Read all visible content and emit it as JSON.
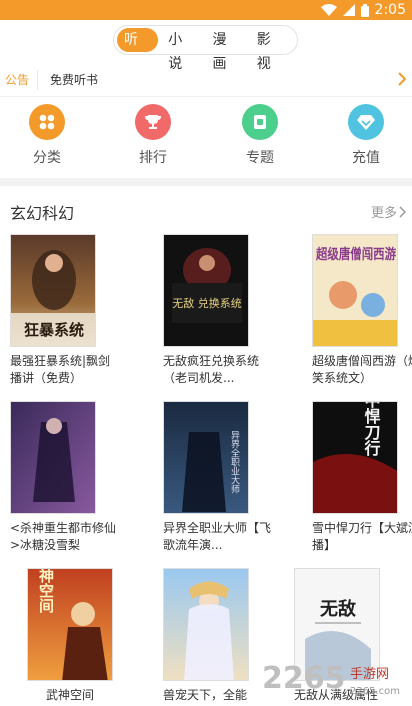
{
  "status": {
    "time": "2:05"
  },
  "tabs": [
    {
      "label": "听书",
      "active": true
    },
    {
      "label": "小说",
      "active": false
    },
    {
      "label": "漫画",
      "active": false
    },
    {
      "label": "影视",
      "active": false
    }
  ],
  "notice": {
    "tag": "公告",
    "text": "免费听书"
  },
  "quick_nav": [
    {
      "label": "分类",
      "icon": "grid-icon",
      "color": "#f39a2a"
    },
    {
      "label": "排行",
      "icon": "trophy-icon",
      "color": "#f06a6a"
    },
    {
      "label": "专题",
      "icon": "topic-icon",
      "color": "#4ccf8c"
    },
    {
      "label": "充值",
      "icon": "diamond-icon",
      "color": "#4fc3e0"
    }
  ],
  "section": {
    "title": "玄幻科幻",
    "more": "更多"
  },
  "books": [
    {
      "title": "最强狂暴系统|飘剑播讲（免费）",
      "cover_text": "狂暴系统"
    },
    {
      "title": "无敌疯狂兑换系统（老司机发...",
      "cover_text": "无敌 兑换系统"
    },
    {
      "title": "超级唐僧闯西游（爆笑系统文）",
      "cover_text": "超级唐僧闯西游"
    },
    {
      "title": "<杀神重生都市修仙>冰糖没雪梨",
      "cover_text": ""
    },
    {
      "title": "异界全职业大师【飞歌流年演...",
      "cover_text": "异界全职业大师"
    },
    {
      "title": "雪中悍刀行【大斌演播】",
      "cover_text": "雪中悍刀行"
    },
    {
      "title": "武神空间",
      "cover_text": "武神空间"
    },
    {
      "title": "兽宠天下，全能",
      "cover_text": ""
    },
    {
      "title": "无敌从满级属性",
      "cover_text": "无敌"
    }
  ],
  "watermark": {
    "text": "2265",
    "sub": "手游网",
    "url": "2265.com"
  },
  "colors": {
    "accent": "#f39a2a"
  }
}
